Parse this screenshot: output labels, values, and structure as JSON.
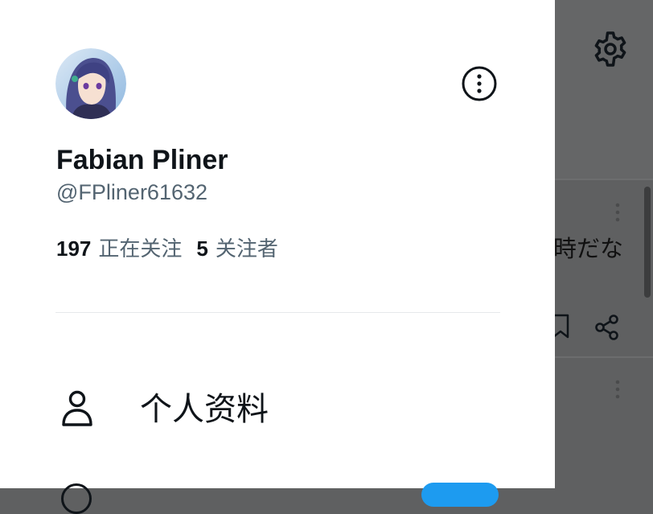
{
  "background": {
    "tweet_text_fragment": "時だな"
  },
  "profile": {
    "display_name": "Fabian Pliner",
    "handle": "@FPliner61632",
    "following_count": "197",
    "following_label": "正在关注",
    "followers_count": "5",
    "followers_label": "关注者"
  },
  "menu": {
    "items": [
      {
        "label": "个人资料",
        "icon": "person-icon"
      }
    ]
  },
  "colors": {
    "overlay": "#5f6061",
    "drawer_bg": "#ffffff",
    "primary_text": "#0f1419",
    "secondary_text": "#536471",
    "accent": "#1d9bf0"
  }
}
